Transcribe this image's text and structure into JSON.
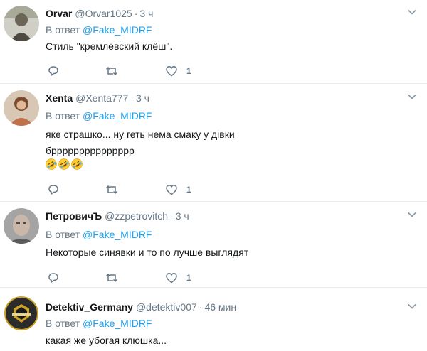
{
  "replies": [
    {
      "name": "Orvar",
      "handle": "@Orvar1025",
      "dot": "·",
      "time": "3 ч",
      "reply_prefix": "В ответ",
      "reply_mention": "@Fake_MIDRF",
      "text_lines": [
        "Стиль \"кремлёвский клёш\"."
      ],
      "likes": "1",
      "avatar_color": "#7a7a6a"
    },
    {
      "name": "Xenta",
      "handle": "@Xenta777",
      "dot": "·",
      "time": "3 ч",
      "reply_prefix": "В ответ",
      "reply_mention": "@Fake_MIDRF",
      "text_lines": [
        "яке страшко... ну геть нема смаку у дівки",
        "бррррррррррррррр"
      ],
      "emoji": [
        "rofl-emoji",
        "rofl-emoji",
        "rofl-emoji"
      ],
      "likes": "1",
      "avatar_color": "#b9785a"
    },
    {
      "name": "ПетровичЪ",
      "handle": "@zzpetrovitch",
      "dot": "·",
      "time": "3 ч",
      "reply_prefix": "В ответ",
      "reply_mention": "@Fake_MIDRF",
      "text_lines": [
        "Некоторые синявки и то по лучше выглядят"
      ],
      "likes": "1",
      "avatar_color": "#8c8c8c"
    },
    {
      "name": "Detektiv_Germany",
      "handle": "@detektiv007",
      "dot": "·",
      "time": "46 мин",
      "reply_prefix": "В ответ",
      "reply_mention": "@Fake_MIDRF",
      "text_lines": [
        "какая же убогая клюшка..."
      ],
      "avatar_color": "#e8d9a0"
    }
  ],
  "colors": {
    "link": "#1da1f2",
    "muted": "#657786",
    "text": "#14171a",
    "divider": "#e6ecf0"
  }
}
